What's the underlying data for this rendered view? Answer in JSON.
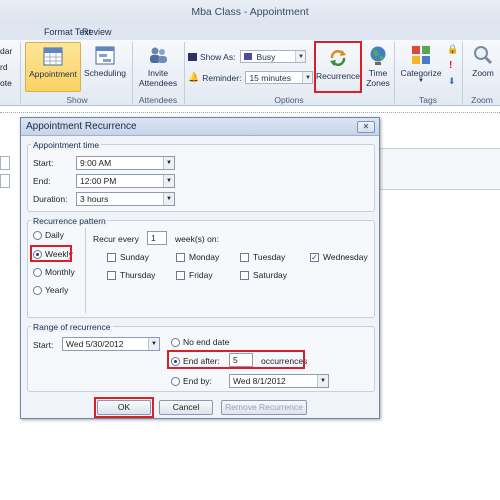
{
  "window": {
    "title": "Mba Class  -  Appointment"
  },
  "ribbon_tabs": [
    "Format Text",
    "Review"
  ],
  "left_cut_labels": [
    "dar",
    "rd",
    "ote"
  ],
  "ribbon": {
    "show_group": {
      "label": "Show",
      "appointment": "Appointment",
      "scheduling": "Scheduling"
    },
    "attendees_group": {
      "label": "Attendees",
      "invite": "Invite\nAttendees",
      "invite_l1": "Invite",
      "invite_l2": "Attendees"
    },
    "options_group": {
      "label": "Options",
      "show_as_label": "Show As:",
      "show_as_value": "Busy",
      "reminder_label": "Reminder:",
      "reminder_value": "15 minutes",
      "recurrence": "Recurrence",
      "time_zones_l1": "Time",
      "time_zones_l2": "Zones"
    },
    "tags_group": {
      "label": "Tags",
      "categorize": "Categorize"
    },
    "zoom_group": {
      "label": "Zoom",
      "zoom": "Zoom"
    }
  },
  "dialog": {
    "title": "Appointment Recurrence",
    "close_glyph": "✕",
    "appointment_time": {
      "label": "Appointment time",
      "start_label": "Start:",
      "start_value": "9:00 AM",
      "end_label": "End:",
      "end_value": "12:00 PM",
      "duration_label": "Duration:",
      "duration_value": "3 hours"
    },
    "recurrence_pattern": {
      "label": "Recurrence pattern",
      "options": [
        "Daily",
        "Weekly",
        "Monthly",
        "Yearly"
      ],
      "selected": "Weekly",
      "recur_every_label": "Recur every",
      "recur_every_value": "1",
      "weeks_on_label": "week(s) on:",
      "days": [
        {
          "name": "Sunday",
          "checked": false
        },
        {
          "name": "Monday",
          "checked": false
        },
        {
          "name": "Tuesday",
          "checked": false
        },
        {
          "name": "Wednesday",
          "checked": true
        },
        {
          "name": "Thursday",
          "checked": false
        },
        {
          "name": "Friday",
          "checked": false
        },
        {
          "name": "Saturday",
          "checked": false
        }
      ]
    },
    "range": {
      "label": "Range of recurrence",
      "start_label": "Start:",
      "start_value": "Wed 5/30/2012",
      "no_end_label": "No end date",
      "end_after_label": "End after:",
      "end_after_value": "5",
      "occurrences_label": "occurrences",
      "end_by_label": "End by:",
      "end_by_value": "Wed 8/1/2012",
      "selected": "End after"
    },
    "buttons": {
      "ok": "OK",
      "cancel": "Cancel",
      "remove": "Remove Recurrence"
    }
  },
  "colors": {
    "highlight": "#d62128",
    "active_button": "#fbd263",
    "dialog_bg": "#f0f3f8"
  }
}
